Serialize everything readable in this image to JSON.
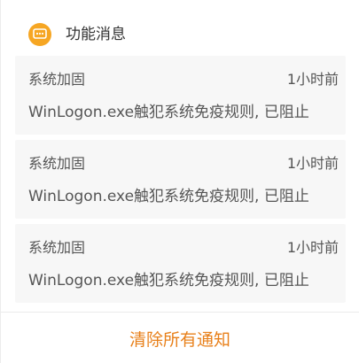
{
  "header": {
    "icon": "message-bubble-icon",
    "icon_color": "#f6a623",
    "title": "功能消息"
  },
  "notifications": [
    {
      "title": "系统加固",
      "time": "1小时前",
      "message": "WinLogon.exe触犯系统免疫规则, 已阻止"
    },
    {
      "title": "系统加固",
      "time": "1小时前",
      "message": "WinLogon.exe触犯系统免疫规则, 已阻止"
    },
    {
      "title": "系统加固",
      "time": "1小时前",
      "message": "WinLogon.exe触犯系统免疫规则, 已阻止"
    }
  ],
  "footer": {
    "clear_all_label": "清除所有通知",
    "accent_color": "#e8801a"
  }
}
